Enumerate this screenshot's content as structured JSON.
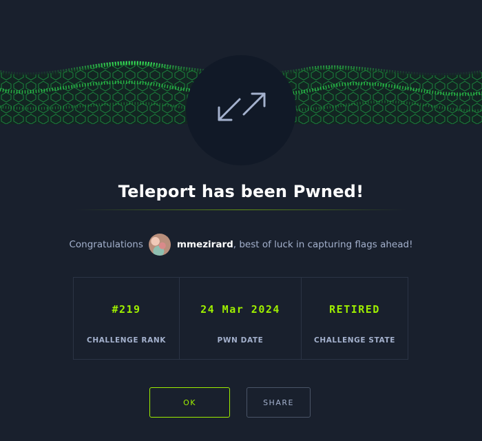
{
  "dialog": {
    "title": "Teleport has been Pwned!",
    "congrats_prefix": "Congratulations",
    "username": "mmezirard",
    "congrats_suffix": ", best of luck in capturing flags ahead!"
  },
  "stats": [
    {
      "value": "#219",
      "label": "CHALLENGE RANK"
    },
    {
      "value": "24 Mar 2024",
      "label": "PWN DATE"
    },
    {
      "value": "RETIRED",
      "label": "CHALLENGE STATE"
    }
  ],
  "buttons": {
    "ok": "OK",
    "share": "SHARE"
  },
  "icons": {
    "emblem": "teleport-arrows-icon"
  },
  "colors": {
    "accent": "#9fef00",
    "background": "#19202d",
    "emblem_bg": "#111927",
    "text_muted": "#a4b1cd"
  }
}
